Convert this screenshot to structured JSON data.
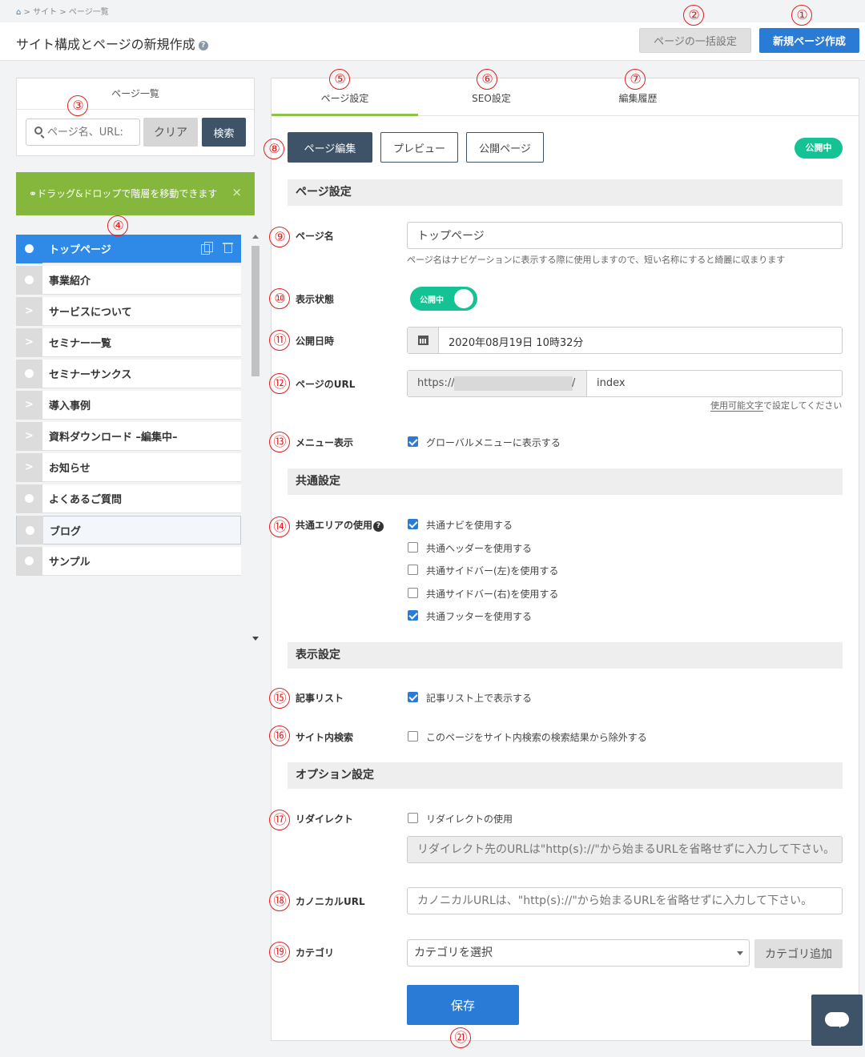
{
  "breadcrumb": {
    "home_icon": "house-icon",
    "separator": ">",
    "site": "サイト",
    "pages": "ページ一覧"
  },
  "header": {
    "title": "サイト構成とページの新規作成",
    "help": "?",
    "bulk_button": "ページの一括設定",
    "new_button": "新規ページ作成"
  },
  "left": {
    "title": "ページ一覧",
    "search_placeholder": "ページ名、URL:",
    "clear_button": "クリア",
    "search_button": "検索",
    "drag_notice": "ドラッグ&ドロップで階層を移動できます",
    "drag_notice_icon": "lightbulb-icon",
    "close_glyph": "×",
    "items": [
      {
        "label": "トップページ",
        "kind": "dot"
      },
      {
        "label": "事業紹介",
        "kind": "dot"
      },
      {
        "label": "サービスについて",
        "kind": "expand"
      },
      {
        "label": "セミナー一覧",
        "kind": "expand"
      },
      {
        "label": "セミナーサンクス",
        "kind": "dot"
      },
      {
        "label": "導入事例",
        "kind": "expand"
      },
      {
        "label": "資料ダウンロード –編集中–",
        "kind": "expand"
      },
      {
        "label": "お知らせ",
        "kind": "expand"
      },
      {
        "label": "よくあるご質問",
        "kind": "dot"
      },
      {
        "label": "ブログ",
        "kind": "dot"
      },
      {
        "label": "サンプル",
        "kind": "dot"
      }
    ],
    "expand_glyph": ">"
  },
  "tabs": [
    "ページ設定",
    "SEO設定",
    "編集履歴"
  ],
  "actions": {
    "edit": "ページ編集",
    "preview": "プレビュー",
    "public_page": "公開ページ",
    "status": "公開中"
  },
  "sections": {
    "page": "ページ設定",
    "common": "共通設定",
    "display": "表示設定",
    "options": "オプション設定"
  },
  "fields": {
    "page_name": {
      "label": "ページ名",
      "value": "トップページ",
      "hint": "ページ名はナビゲーションに表示する際に使用しますので、短い名称にすると綺麗に収まります"
    },
    "visibility": {
      "label": "表示状態",
      "toggle": "公開中"
    },
    "publish_date": {
      "label": "公開日時",
      "value": "2020年08月19日 10時32分"
    },
    "url": {
      "label": "ページのURL",
      "prefix": "https://",
      "slash": "/",
      "value": "index",
      "hint_link": "使用可能文字",
      "hint_rest": "で設定してください"
    },
    "menu": {
      "label": "メニュー表示",
      "option": "グローバルメニューに表示する"
    },
    "common_area": {
      "label": "共通エリアの使用",
      "help": "?",
      "options": [
        {
          "label": "共通ナビを使用する",
          "checked": true
        },
        {
          "label": "共通ヘッダーを使用する",
          "checked": false
        },
        {
          "label": "共通サイドバー(左)を使用する",
          "checked": false
        },
        {
          "label": "共通サイドバー(右)を使用する",
          "checked": false
        },
        {
          "label": "共通フッターを使用する",
          "checked": true
        }
      ]
    },
    "article_list": {
      "label": "記事リスト",
      "option": "記事リスト上で表示する"
    },
    "site_search": {
      "label": "サイト内検索",
      "option": "このページをサイト内検索の検索結果から除外する"
    },
    "redirect": {
      "label": "リダイレクト",
      "option": "リダイレクトの使用",
      "placeholder": "リダイレクト先のURLは\"http(s)://\"から始まるURLを省略せずに入力して下さい。"
    },
    "canonical": {
      "label": "カノニカルURL",
      "placeholder": "カノニカルURLは、\"http(s)://\"から始まるURLを省略せずに入力して下さい。"
    },
    "category": {
      "label": "カテゴリ",
      "select": "カテゴリを選択",
      "add_button": "カテゴリ追加"
    }
  },
  "save_button": "保存",
  "chat_icon": "chat-icon",
  "annotations": [
    "①",
    "②",
    "③",
    "④",
    "⑤",
    "⑥",
    "⑦",
    "⑧",
    "⑨",
    "⑩",
    "⑪",
    "⑫",
    "⑬",
    "⑭",
    "⑮",
    "⑯",
    "⑰",
    "⑱",
    "⑲",
    "㉑"
  ],
  "colors": {
    "primary": "#2a7bd6",
    "dark": "#3e5368",
    "success": "#15c293",
    "notice": "#86b73d",
    "annotation": "#e02020"
  }
}
